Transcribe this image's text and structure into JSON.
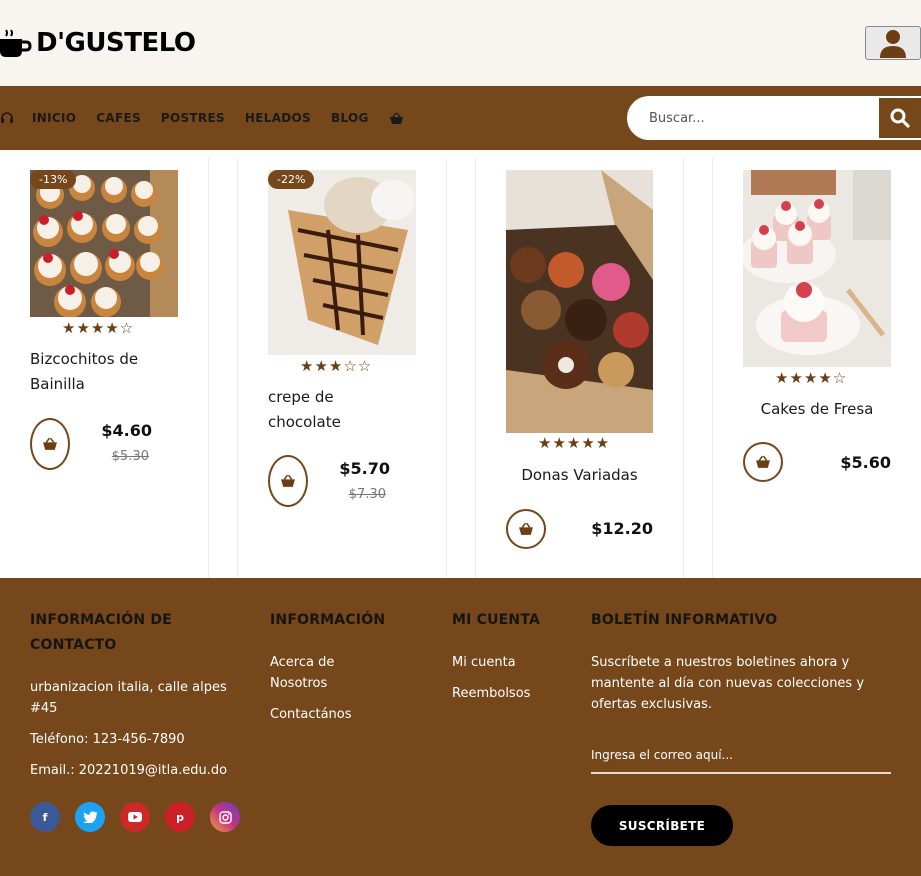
{
  "brand": {
    "name": "D'GUSTELO"
  },
  "nav": {
    "items": [
      "INICIO",
      "CAFES",
      "POSTRES",
      "HELADOS",
      "BLOG"
    ]
  },
  "search": {
    "placeholder": "Buscar..."
  },
  "products": [
    {
      "name_line1": "Bizcochitos de",
      "name_line2": "Bainilla",
      "badge": "-13%",
      "rating": 4,
      "price": "$4.60",
      "old_price": "$5.30"
    },
    {
      "name_line1": "crepe de",
      "name_line2": "chocolate",
      "badge": "-22%",
      "rating": 3,
      "price": "$5.70",
      "old_price": "$7.30"
    },
    {
      "name": "Donas Variadas",
      "rating": 5,
      "price": "$12.20"
    },
    {
      "name": "Cakes de Fresa",
      "rating": 4,
      "price": "$5.60"
    }
  ],
  "footer": {
    "contact": {
      "title_line1": "INFORMACIÓN DE",
      "title_line2": "CONTACTO",
      "address_line1": "urbanizacion italia, calle alpes",
      "address_line2": "#45",
      "phone": "Teléfono: 123-456-7890",
      "email": "Email.: 20221019@itla.edu.do"
    },
    "info": {
      "title": "INFORMACIÓN",
      "link1_line1": "Acerca de",
      "link1_line2": "Nosotros",
      "link2": "Contactános"
    },
    "account": {
      "title": "MI CUENTA",
      "link1": "Mi cuenta",
      "link2": "Reembolsos"
    },
    "newsletter": {
      "title": "BOLETÍN INFORMATIVO",
      "text_line1": "Suscríbete a nuestros boletines ahora y",
      "text_line2": "mantente al día con nuevas colecciones y",
      "text_line3": "ofertas exclusivas.",
      "placeholder": "Ingresa el correo aquí...",
      "button": "SUSCRÍBETE"
    },
    "social_colors": {
      "facebook": "#3b5998",
      "twitter": "#1da1f2",
      "youtube": "#cc2a2a",
      "pinterest": "#cb2027",
      "instagram": "#c13584"
    }
  },
  "colors": {
    "brand_brown": "#75471a",
    "header_bg": "#f8f5f1"
  }
}
